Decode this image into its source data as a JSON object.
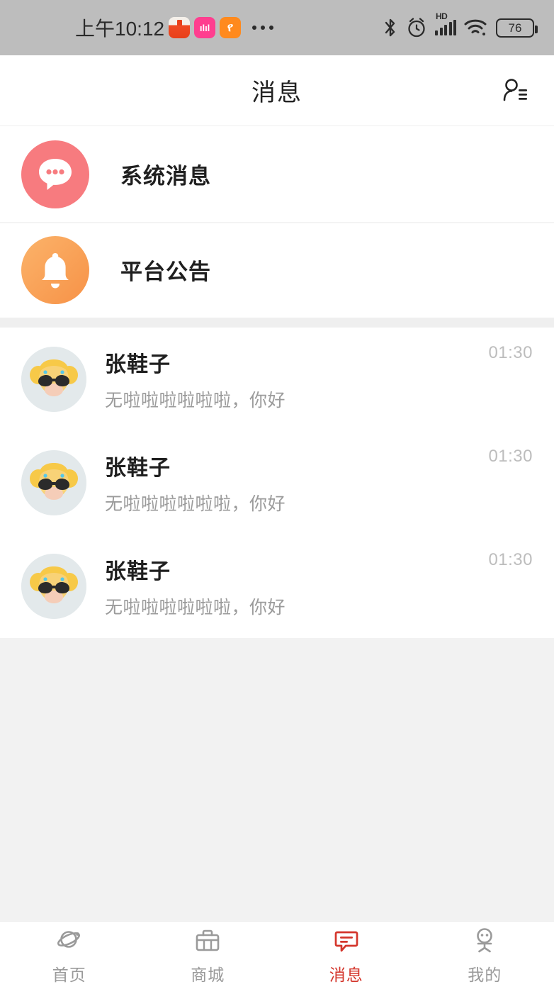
{
  "status_bar": {
    "time": "上午10:12",
    "battery_level": "76",
    "network_type": "HD",
    "icons": [
      "notification-app-1",
      "notification-app-2",
      "notification-app-3",
      "overflow-dots",
      "bluetooth-icon",
      "alarm-icon",
      "hd-signal-icon",
      "wifi-icon",
      "battery-icon"
    ],
    "background": "#BDBDBD"
  },
  "header": {
    "title": "消息",
    "action_icon": "contacts-icon"
  },
  "system_entries": [
    {
      "label": "系统消息",
      "icon": "chat-bubble-icon",
      "color": "#F77B7F"
    },
    {
      "label": "平台公告",
      "icon": "bell-icon",
      "color": "#F79247"
    }
  ],
  "conversations": [
    {
      "name": "张鞋子",
      "message": "无啦啦啦啦啦啦，你好",
      "time": "01:30",
      "avatar": "girl-sunglasses-avatar"
    },
    {
      "name": "张鞋子",
      "message": "无啦啦啦啦啦啦，你好",
      "time": "01:30",
      "avatar": "girl-sunglasses-avatar"
    },
    {
      "name": "张鞋子",
      "message": "无啦啦啦啦啦啦，你好",
      "time": "01:30",
      "avatar": "girl-sunglasses-avatar"
    }
  ],
  "tab_bar": {
    "active_color": "#D4362C",
    "inactive_color": "#9A9A9A",
    "tabs": [
      {
        "label": "首页",
        "icon": "planet-icon",
        "active": false
      },
      {
        "label": "商城",
        "icon": "shop-bag-icon",
        "active": false
      },
      {
        "label": "消息",
        "icon": "message-icon",
        "active": true
      },
      {
        "label": "我的",
        "icon": "person-icon",
        "active": false
      }
    ]
  }
}
